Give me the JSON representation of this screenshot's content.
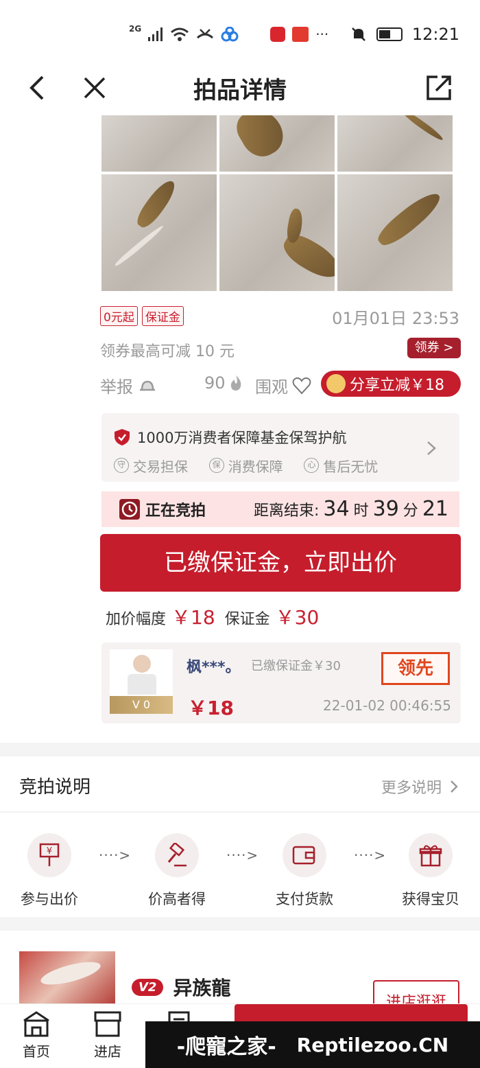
{
  "status_bar": {
    "signal_label": "2G",
    "time": "12:21",
    "dots": "···"
  },
  "header": {
    "title": "拍品详情"
  },
  "item": {
    "tags": [
      "0元起",
      "保证金"
    ],
    "datetime": "01月01日 23:53",
    "coupon_text": "领券最高可减 10 元",
    "coupon_button": "领券 >",
    "report_label": "举报",
    "hot_count": "90",
    "watch_label": "围观",
    "share_label": "分享立减￥18"
  },
  "guarantee": {
    "title": "1000万消费者保障基金保驾护航",
    "items": [
      {
        "icon_char": "守",
        "label": "交易担保"
      },
      {
        "icon_char": "保",
        "label": "消费保障"
      },
      {
        "icon_char": "心",
        "label": "售后无忧"
      }
    ]
  },
  "auction": {
    "status": "正在竞拍",
    "countdown_label": "距离结束:",
    "hours": "34",
    "hours_unit": "时",
    "minutes": "39",
    "minutes_unit": "分",
    "seconds": "21",
    "bid_button": "已缴保证金，立即出价",
    "increment_label": "加价幅度",
    "increment_value": "￥18",
    "deposit_label": "保证金",
    "deposit_value": "￥30"
  },
  "top_bidder": {
    "name": "枫***。",
    "deposit_note": "已缴保证金￥30",
    "leader_badge": "领先",
    "level": "V 0",
    "price": "￥18",
    "time": "22-01-02 00:46:55"
  },
  "rules": {
    "title": "竞拍说明",
    "more": "更多说明",
    "steps": [
      {
        "icon": "bid-sign-icon",
        "label": "参与出价"
      },
      {
        "icon": "gavel-icon",
        "label": "价高者得"
      },
      {
        "icon": "wallet-icon",
        "label": "支付货款"
      },
      {
        "icon": "gift-icon",
        "label": "获得宝贝"
      }
    ],
    "arrow": "····>"
  },
  "shop": {
    "level_badge": "V2",
    "name": "异族龍",
    "enter_button": "进店逛逛"
  },
  "tabbar": {
    "home": "首页",
    "store": "进店"
  },
  "watermark": {
    "brand": "-爬寵之家-",
    "site": "Reptilezoo.CN"
  },
  "colors": {
    "accent": "#c51d2c",
    "leader": "#e0461e",
    "countdown_bg": "#fde3e3"
  }
}
